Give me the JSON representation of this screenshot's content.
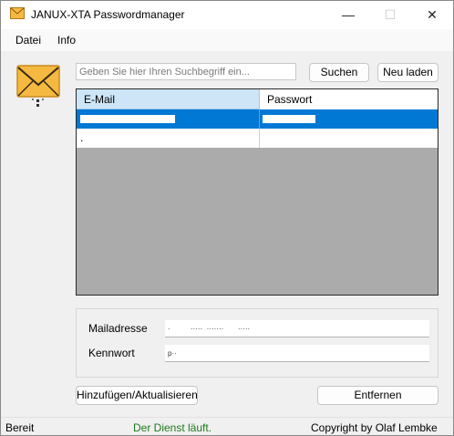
{
  "window": {
    "title": "JANUX-XTA Passwordmanager",
    "icon": "envelope-icon",
    "controls": {
      "minimize": "—",
      "maximize": "☐",
      "close": "✕"
    }
  },
  "menu": {
    "items": [
      "Datei",
      "Info"
    ]
  },
  "search": {
    "placeholder": "Geben Sie hier Ihren Suchbegriff ein...",
    "value": ""
  },
  "toolbar": {
    "search_label": "Suchen",
    "reload_label": "Neu laden"
  },
  "grid": {
    "columns": [
      "E-Mail",
      "Passwort"
    ],
    "rows": [
      {
        "email": "",
        "password": "",
        "selected": true
      },
      {
        "email": ".",
        "password": "",
        "selected": false
      }
    ]
  },
  "form": {
    "mail_label": "Mailadresse",
    "mail_value": "·          ·····  ·······       ·····",
    "password_label": "Kennwort",
    "password_value": "p··"
  },
  "actions": {
    "add_update_label": "Hinzufügen/Aktualisieren",
    "remove_label": "Entfernen"
  },
  "status": {
    "left": "Bereit",
    "center": "Der Dienst läuft.",
    "right": "Copyright by Olaf Lembke"
  },
  "colors": {
    "selection": "#0078d4",
    "status_ok": "#1e7a1e",
    "envelope": "#f5b841"
  }
}
